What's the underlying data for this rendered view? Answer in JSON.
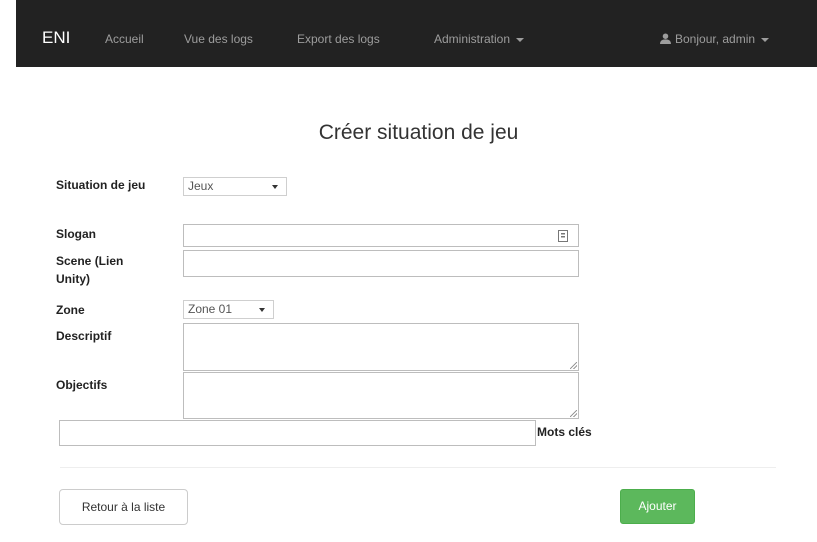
{
  "navbar": {
    "brand": "ENI",
    "links": [
      "Accueil",
      "Vue des logs",
      "Export des logs",
      "Administration"
    ],
    "user_menu": "Bonjour, admin"
  },
  "page": {
    "title": "Créer situation de jeu"
  },
  "form": {
    "situation_label": "Situation de jeu",
    "situation_value": "Jeux",
    "slogan_label": "Slogan",
    "slogan_value": "",
    "scene_label": "Scene (Lien Unity)",
    "scene_value": "",
    "zone_label": "Zone",
    "zone_value": "Zone 01",
    "descriptif_label": "Descriptif",
    "objectifs_label": "Objectifs",
    "keywords_label": "Mots clés",
    "keywords_value": ""
  },
  "buttons": {
    "back": "Retour à la liste",
    "add": "Ajouter"
  },
  "colors": {
    "navbar_bg": "#222222",
    "success": "#5cb85c"
  }
}
